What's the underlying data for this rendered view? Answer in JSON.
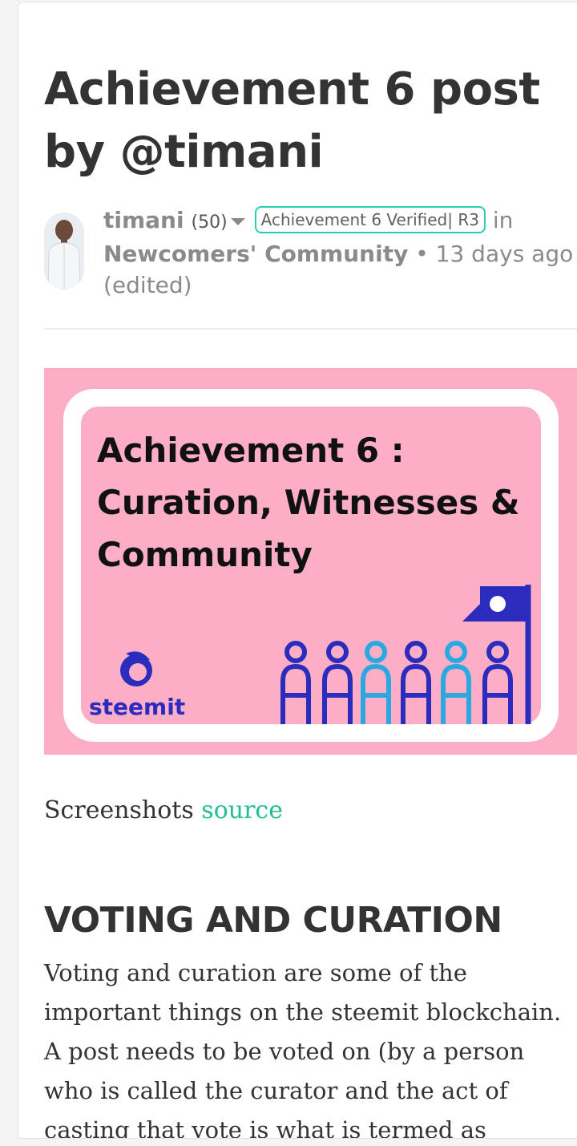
{
  "post": {
    "title": "Achievement 6 post by @timani",
    "author": "timani",
    "reputation": "(50)",
    "badge": "Achievement 6 Verified| R3",
    "in_label": " in",
    "community": "Newcomers' Community",
    "separator": " • ",
    "time_ago": "13 days ago",
    "edited": "(edited)"
  },
  "hero_image": {
    "text_line1": "Achievement 6 :",
    "text_line2": "Curation, Witnesses &",
    "text_line3": "Community",
    "logo_word": "steemit",
    "colors": {
      "background": "#fcaec7",
      "frame": "#ffffff",
      "people_dark": "#2b2bbd",
      "people_light": "#2aa9e0"
    }
  },
  "caption": {
    "prefix": "Screenshots ",
    "link": "source"
  },
  "section": {
    "heading": "VOTING AND CURATION",
    "paragraph": "Voting and curation are some of the important things on the steemit blockchain. A post needs to be voted on (by a person who is called the curator and the act of casting that vote is what is termed as curation) so"
  },
  "icons": {
    "flag": "flag-icon",
    "caret": "caret-down-icon",
    "steemit_logo": "steemit-logo-icon"
  },
  "colors": {
    "accent": "#27d0b5",
    "link": "#1fbf8f",
    "text": "#333333",
    "meta": "#8a8a8a"
  }
}
